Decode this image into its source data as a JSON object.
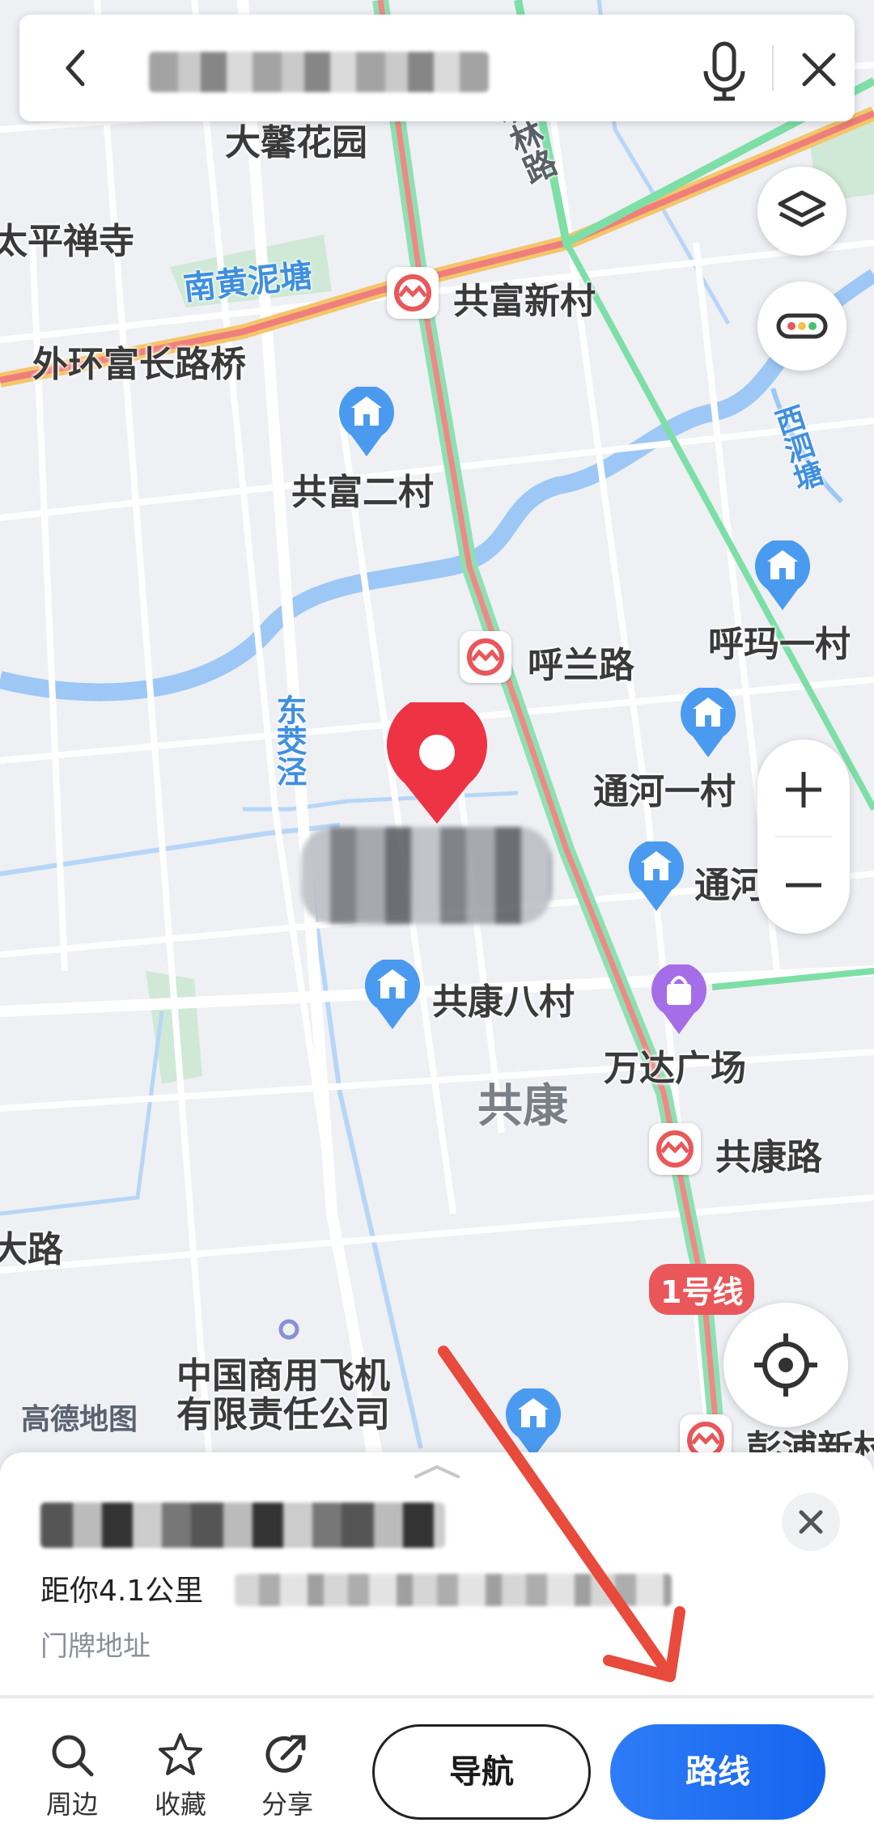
{
  "search": {
    "query_blurred": true
  },
  "map": {
    "pois": [
      {
        "label": "大馨花园"
      },
      {
        "label": "太平禅寺"
      },
      {
        "label": "共富新村"
      },
      {
        "label": "外环富长路桥"
      },
      {
        "label": "共富二村"
      },
      {
        "label": "呼兰路"
      },
      {
        "label": "呼玛一村"
      },
      {
        "label": "通河一村"
      },
      {
        "label": "通河"
      },
      {
        "label": "共康八村"
      },
      {
        "label": "万达广场"
      },
      {
        "label": "共康路"
      },
      {
        "label": "中国商用飞机"
      },
      {
        "label": "有限责任公司"
      },
      {
        "label": "彭浦新村"
      },
      {
        "label": "大路"
      }
    ],
    "area_label": "共康",
    "water_labels": [
      "南黄泥塘",
      "东茭泾",
      "西泗塘"
    ],
    "road_labels": [
      "联林路"
    ],
    "metro_line": "1号线",
    "logo": "高德地图",
    "colors": {
      "metro_red": "#e9575a",
      "water": "#9dc8f5",
      "pin_red": "#ee3344",
      "poi_blue": "#4a9bef",
      "poi_purple": "#a56ee8"
    }
  },
  "card": {
    "distance": "距你4.1公里",
    "house_number": "门牌地址"
  },
  "toolbar": {
    "nearby": "周边",
    "favorite": "收藏",
    "share": "分享",
    "navigate": "导航",
    "route": "路线"
  },
  "icons": [
    "back-icon",
    "microphone-icon",
    "close-icon",
    "layers-icon",
    "traffic-icon",
    "zoom-in-icon",
    "zoom-out-icon",
    "locate-icon",
    "search-icon",
    "star-icon",
    "share-icon"
  ]
}
